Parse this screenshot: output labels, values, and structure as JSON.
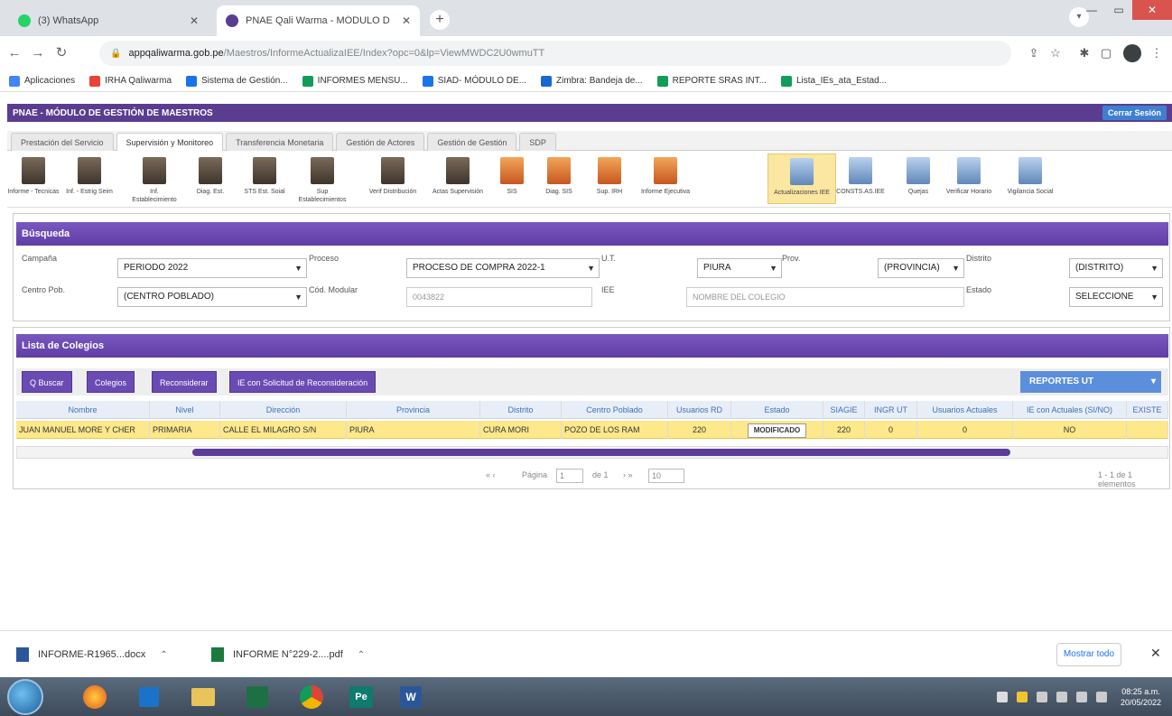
{
  "browser": {
    "tabs": [
      {
        "title": "(3) WhatsApp",
        "icon": "whatsapp-icon",
        "active": false
      },
      {
        "title": "PNAE Qali Warma - MÓDULO D",
        "icon": "qaliwarma-icon",
        "active": true
      }
    ],
    "new_tab": "+",
    "url_domain": "appqaliwarma.gob.pe",
    "url_path": "/Maestros/InformeActualizaIEE/Index?opc=0&lp=ViewMWDC2U0wmuTT",
    "bookmarks": [
      {
        "label": "Aplicaciones",
        "color": "#4285f4"
      },
      {
        "label": "IRHA Qaliwarma",
        "color": "#ea4335"
      },
      {
        "label": "Sistema de Gestión...",
        "color": "#1a73e8"
      },
      {
        "label": "INFORMES MENSU...",
        "color": "#0f9d58"
      },
      {
        "label": "SIAD- MÓDULO DE...",
        "color": "#1a73e8"
      },
      {
        "label": "Zimbra: Bandeja de...",
        "color": "#1967d2"
      },
      {
        "label": "REPORTE SRAS INT...",
        "color": "#0f9d58"
      },
      {
        "label": "Lista_IEs_ata_Estad...",
        "color": "#0f9d58"
      }
    ]
  },
  "app": {
    "header_title": "PNAE - MÓDULO DE GESTIÓN DE MAESTROS",
    "user_label": "Cerrar Sesión",
    "tabs": [
      "Prestación del Servicio",
      "Supervisión y Monitoreo",
      "Transferencia Monetaria",
      "Gestión de Actores",
      "Gestión de Gestión",
      "SDP"
    ],
    "tools": [
      "Informe - Tecnicas",
      "Inf. - Estrig Seim",
      "Inf. Establecimiento",
      "Diag. Est.",
      "STS Est. Soial",
      "Sup Establecimientos",
      "Verif Distribución",
      "Actas Supervisión",
      "SIS",
      "Diag. SIS",
      "Sup. IRH",
      "Informe Ejecutiva",
      "Actualizaciones IEE",
      "CONSTS.AS.IEE",
      "Quejas",
      "Verificar Horario",
      "Vigilancia Social"
    ],
    "search": {
      "title": "Búsqueda",
      "labels": {
        "campana": "Campaña",
        "proceso": "Proceso",
        "ut": "U.T.",
        "prov": "Prov.",
        "dist": "Distrito",
        "centro": "Centro Pob.",
        "cod_modular": "Cód. Modular",
        "iee": "IEE",
        "estado": "Estado"
      },
      "values": {
        "campana": "PERIODO 2022",
        "proceso": "PROCESO DE COMPRA 2022-1",
        "ut": "PIURA",
        "prov": "(PROVINCIA)",
        "dist": "(DISTRITO)",
        "centro": "(CENTRO POBLADO)",
        "estado": "SELECCIONE"
      },
      "placeholders": {
        "cod_modular": "0043822",
        "iee": "NOMBRE DEL COLEGIO"
      }
    },
    "list": {
      "title": "Lista de Colegios",
      "buttons": [
        "Q Buscar",
        "Colegios",
        "Reconsiderar",
        "IE con Solicitud de Reconsideración"
      ],
      "reportes": "REPORTES UT",
      "columns": [
        "Nombre",
        "Nivel",
        "Dirección",
        "Provincia",
        "Distrito",
        "Centro Poblado",
        "Usuarios RD",
        "Estado",
        "SIAGIE",
        "INGR UT",
        "Usuarios Actuales",
        "IE con Actuales (SI/NO)",
        "EXISTE"
      ],
      "rows": [
        {
          "nombre": "JUAN MANUEL MORE Y CHER",
          "nivel": "PRIMARIA",
          "direccion": "CALLE EL MILAGRO S/N",
          "provincia": "PIURA",
          "distrito": "CURA MORI",
          "centro": "POZO DE LOS RAM",
          "usuarios_rd": "220",
          "estado": "MODIFICADO",
          "siagie": "220",
          "ingr_ut": "0",
          "usuarios_act": "0",
          "ie_act": "NO",
          "existe": ""
        }
      ],
      "pager": {
        "prev": "« ‹",
        "page_label": "Página",
        "page_value": "1",
        "of_label": "de 1",
        "next": "› »",
        "size": "10",
        "summary": "1 - 1 de 1 elementos"
      }
    }
  },
  "downloads": [
    {
      "name": "INFORME-R1965...docx",
      "icon": "word-doc-icon"
    },
    {
      "name": "INFORME N°229-2....pdf",
      "icon": "pdf-icon"
    }
  ],
  "downloads_showall": "Mostrar todo",
  "taskbar": {
    "apps": [
      "firefox",
      "outlook",
      "explorer",
      "excel",
      "chrome",
      "powerpoint",
      "word"
    ],
    "clock_time": "08:25 a.m.",
    "clock_date": "20/05/2022"
  },
  "colors": {
    "purple": "#5b3d8f",
    "highlight": "#fde88b",
    "accent": "#5b8fdc"
  }
}
